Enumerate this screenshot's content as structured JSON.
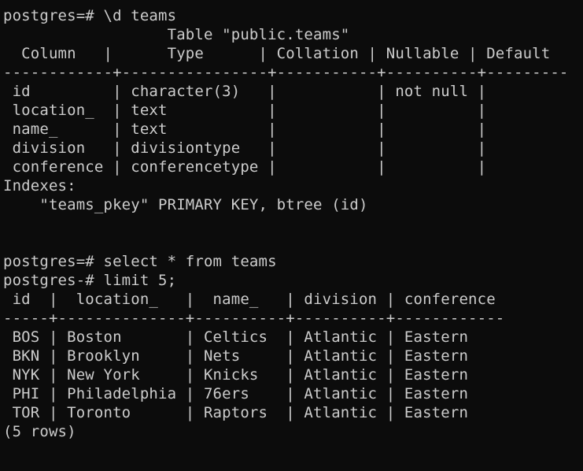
{
  "terminal": {
    "lines": [
      "postgres=# \\d teams",
      "                  Table \"public.teams\"",
      "  Column   |      Type      | Collation | Nullable | Default",
      "------------+----------------+-----------+----------+---------",
      " id         | character(3)   |           | not null |",
      " location_  | text           |           |          |",
      " name_      | text           |           |          |",
      " division   | divisiontype   |           |          |",
      " conference | conferencetype |           |          |",
      "Indexes:",
      "    \"teams_pkey\" PRIMARY KEY, btree (id)",
      "",
      "",
      "postgres=# select * from teams",
      "postgres-# limit 5;",
      " id  |  location_   |  name_   | division | conference",
      "-----+--------------+----------+----------+------------",
      " BOS | Boston       | Celtics  | Atlantic | Eastern",
      " BKN | Brooklyn     | Nets     | Atlantic | Eastern",
      " NYK | New York     | Knicks   | Atlantic | Eastern",
      " PHI | Philadelphia | 76ers    | Atlantic | Eastern",
      " TOR | Toronto      | Raptors  | Atlantic | Eastern",
      "(5 rows)"
    ]
  }
}
